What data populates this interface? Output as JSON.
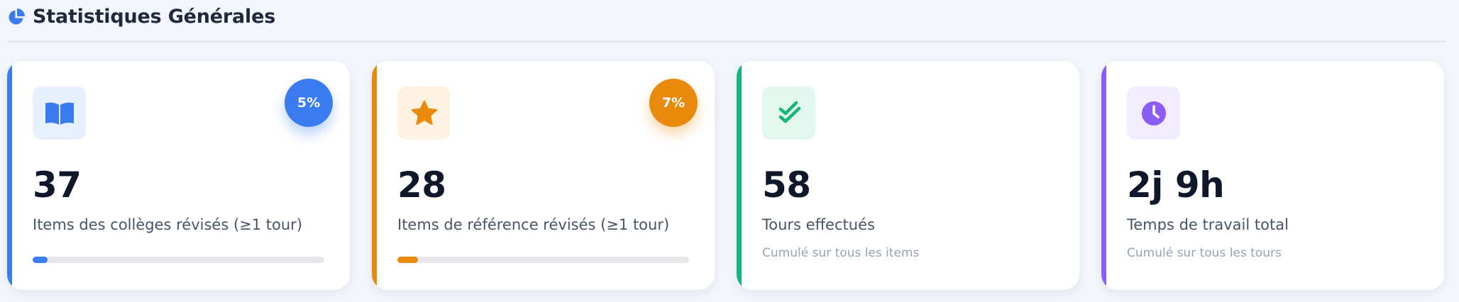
{
  "section": {
    "title": "Statistiques Générales",
    "icon": "pie-chart-icon"
  },
  "colors": {
    "blue": "#3b7bf0",
    "orange": "#ea8a0c",
    "green": "#15b57c",
    "purple": "#8b5cf6"
  },
  "cards": [
    {
      "icon": "book-open-icon",
      "value": "37",
      "label": "Items des collèges révisés (≥1 tour)",
      "badge": "5%",
      "progress": 0.05
    },
    {
      "icon": "star-icon",
      "value": "28",
      "label": "Items de référence révisés (≥1 tour)",
      "badge": "7%",
      "progress": 0.07
    },
    {
      "icon": "double-check-icon",
      "value": "58",
      "label": "Tours effectués",
      "subtitle": "Cumulé sur tous les items"
    },
    {
      "icon": "clock-icon",
      "value": "2j 9h",
      "label": "Temps de travail total",
      "subtitle": "Cumulé sur tous les tours"
    }
  ]
}
